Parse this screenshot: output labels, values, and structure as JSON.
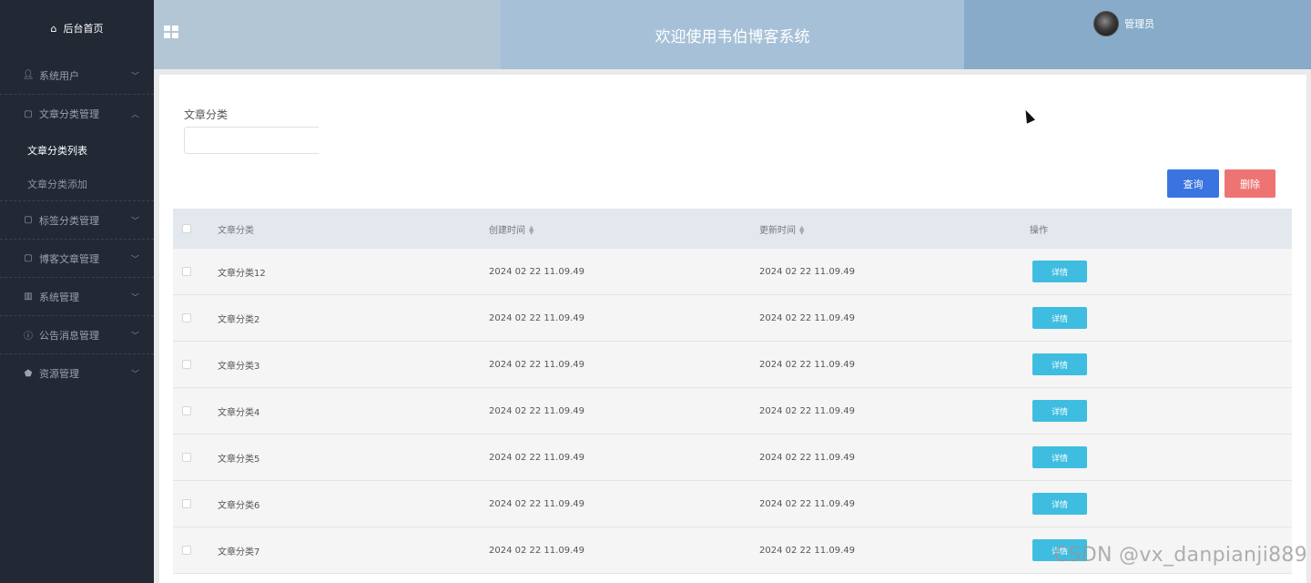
{
  "sidebar": {
    "home_label": "后台首页",
    "groups": [
      {
        "label": "系统用户",
        "icon": "user-icon"
      },
      {
        "label": "文章分类管理",
        "icon": "doc-icon",
        "expanded": true,
        "children": [
          {
            "label": "文章分类列表",
            "active": true
          },
          {
            "label": "文章分类添加"
          }
        ]
      },
      {
        "label": "标签分类管理",
        "icon": "doc-icon"
      },
      {
        "label": "博客文章管理",
        "icon": "doc-icon"
      },
      {
        "label": "系统管理",
        "icon": "chart-icon"
      },
      {
        "label": "公告消息管理",
        "icon": "info-icon"
      },
      {
        "label": "资源管理",
        "icon": "shield-icon"
      }
    ]
  },
  "header": {
    "title": "欢迎使用韦伯博客系统",
    "user_name": "管理员"
  },
  "filter": {
    "label": "文章分类",
    "value": ""
  },
  "actions": {
    "query_label": "查询",
    "delete_label": "删除"
  },
  "table": {
    "headers": {
      "name": "文章分类",
      "created": "创建时间",
      "updated": "更新时间",
      "ops": "操作"
    },
    "detail_label": "详情",
    "rows": [
      {
        "name": "文章分类12",
        "created": "2024 02 22 11.09.49",
        "updated": "2024 02 22 11.09.49"
      },
      {
        "name": "文章分类2",
        "created": "2024 02 22 11.09.49",
        "updated": "2024 02 22 11.09.49"
      },
      {
        "name": "文章分类3",
        "created": "2024 02 22 11.09.49",
        "updated": "2024 02 22 11.09.49"
      },
      {
        "name": "文章分类4",
        "created": "2024 02 22 11.09.49",
        "updated": "2024 02 22 11.09.49"
      },
      {
        "name": "文章分类5",
        "created": "2024 02 22 11.09.49",
        "updated": "2024 02 22 11.09.49"
      },
      {
        "name": "文章分类6",
        "created": "2024 02 22 11.09.49",
        "updated": "2024 02 22 11.09.49"
      },
      {
        "name": "文章分类7",
        "created": "2024 02 22 11.09.49",
        "updated": "2024 02 22 11.09.49"
      }
    ]
  },
  "watermark": "CSDN @vx_danpianji889",
  "colors": {
    "sidebar_bg": "#222834",
    "query_button": "#3a74e0",
    "delete_button": "#ee7474",
    "detail_button": "#3fbde0"
  }
}
